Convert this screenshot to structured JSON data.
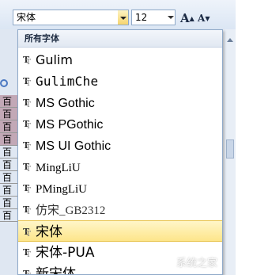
{
  "toolbar": {
    "font_name": "宋体",
    "font_size": "12",
    "grow_font_glyph": "A",
    "shrink_font_glyph": "A"
  },
  "dropdown": {
    "header": "所有字体",
    "fonts": [
      {
        "name": "Gulim",
        "selected": false
      },
      {
        "name": "GulimChe",
        "selected": false
      },
      {
        "name": "MS Gothic",
        "selected": false
      },
      {
        "name": "MS PGothic",
        "selected": false
      },
      {
        "name": "MS UI Gothic",
        "selected": false
      },
      {
        "name": "MingLiU",
        "selected": false
      },
      {
        "name": "PMingLiU",
        "selected": false
      },
      {
        "name": "仿宋_GB2312",
        "selected": false
      },
      {
        "name": "宋体",
        "selected": true
      },
      {
        "name": "宋体-PUA",
        "selected": false
      },
      {
        "name": "新宋体",
        "selected": false
      }
    ]
  },
  "document": {
    "lines": [
      "百",
      "百",
      "百",
      "百",
      "百",
      "百",
      "百",
      "百",
      "百",
      "百"
    ]
  },
  "watermark": "系统之家",
  "colors": {
    "selected_item": "#fde58a",
    "ribbon": "#dbe6f4",
    "border": "#8fa9c8"
  }
}
